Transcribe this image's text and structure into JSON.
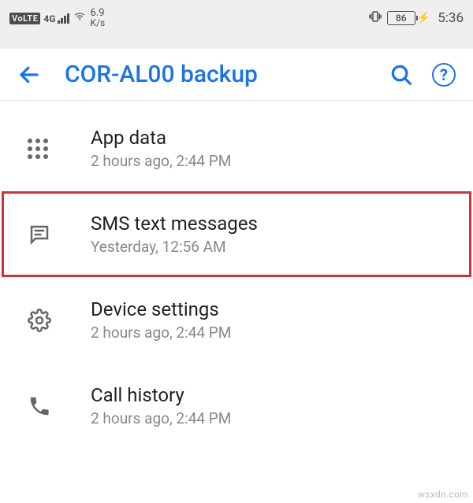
{
  "status": {
    "volte": "VoLTE",
    "network_type": "4G",
    "speed_value": "6.9",
    "speed_unit": "K/s",
    "battery_pct": "86",
    "time": "5:36"
  },
  "appbar": {
    "title": "COR-AL00 backup"
  },
  "items": [
    {
      "title": "App data",
      "subtitle": "2 hours ago, 2:44 PM"
    },
    {
      "title": "SMS text messages",
      "subtitle": "Yesterday, 12:56 AM"
    },
    {
      "title": "Device settings",
      "subtitle": "2 hours ago, 2:44 PM"
    },
    {
      "title": "Call history",
      "subtitle": "2 hours ago, 2:44 PM"
    }
  ],
  "watermark": "wsxdn.com"
}
